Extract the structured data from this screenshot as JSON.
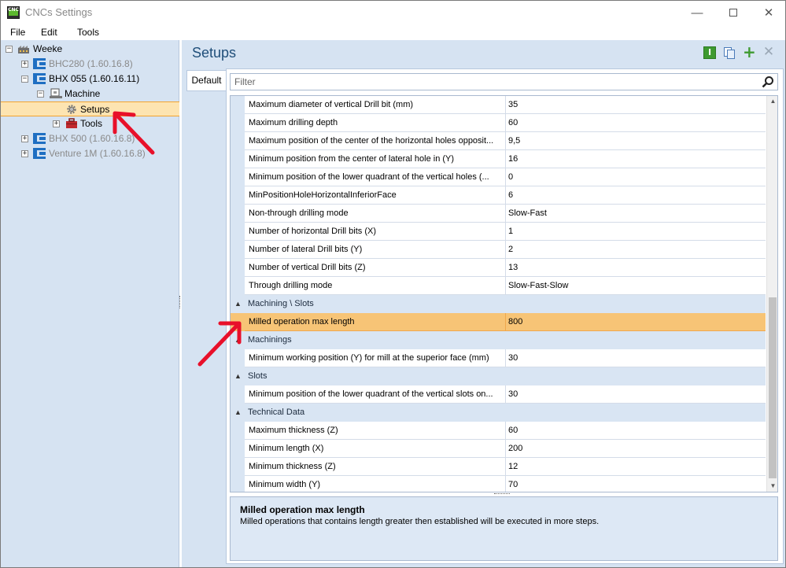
{
  "window": {
    "title": "CNCs Settings",
    "app_icon_text": "CNC",
    "controls": {
      "minimize": "—",
      "maximize": "",
      "close": "✕"
    }
  },
  "menu": {
    "items": [
      "File",
      "Edit",
      "Tools"
    ]
  },
  "tree": {
    "items": [
      {
        "label": "Weeke",
        "expander": "−",
        "icon": "factory-icon",
        "dim": false
      },
      {
        "label": "BHC280 (1.60.16.8)",
        "expander": "+",
        "icon": "cnc-machine-icon",
        "dim": true
      },
      {
        "label": "BHX 055 (1.60.16.11)",
        "expander": "−",
        "icon": "cnc-machine-icon",
        "dim": false
      },
      {
        "label": "Machine",
        "expander": "−",
        "icon": "machine-icon",
        "dim": false
      },
      {
        "label": "Setups",
        "expander": "",
        "icon": "gear-icon",
        "dim": false,
        "selected": true
      },
      {
        "label": "Tools",
        "expander": "+",
        "icon": "toolbox-icon",
        "dim": false
      },
      {
        "label": "BHX 500 (1.60.16.8)",
        "expander": "+",
        "icon": "cnc-machine-icon",
        "dim": true
      },
      {
        "label": "Venture 1M (1.60.16.8)",
        "expander": "+",
        "icon": "cnc-machine-icon",
        "dim": true
      }
    ]
  },
  "content": {
    "title": "Setups",
    "toolbar": {
      "info": "I",
      "copy": "copy-icon",
      "add": "+",
      "delete": "✕"
    },
    "tab_label": "Default",
    "filter_placeholder": "Filter",
    "grid_rows": [
      {
        "type": "property",
        "name": "Maximum diameter of vertical Drill bit (mm)",
        "value": "35"
      },
      {
        "type": "property",
        "name": "Maximum drilling depth",
        "value": "60"
      },
      {
        "type": "property",
        "name": "Maximum position of the center of the horizontal holes opposit...",
        "value": "9,5"
      },
      {
        "type": "property",
        "name": "Minimum position from the center of lateral hole in (Y)",
        "value": "16"
      },
      {
        "type": "property",
        "name": "Minimum position of the lower quadrant of the vertical holes (...",
        "value": "0"
      },
      {
        "type": "property",
        "name": "MinPositionHoleHorizontalInferiorFace",
        "value": "6"
      },
      {
        "type": "property",
        "name": "Non-through drilling mode",
        "value": "Slow-Fast"
      },
      {
        "type": "property",
        "name": "Number of horizontal Drill bits (X)",
        "value": "1"
      },
      {
        "type": "property",
        "name": "Number of lateral Drill bits (Y)",
        "value": "2"
      },
      {
        "type": "property",
        "name": "Number of vertical Drill bits (Z)",
        "value": "13"
      },
      {
        "type": "property",
        "name": "Through drilling mode",
        "value": "Slow-Fast-Slow"
      },
      {
        "type": "category",
        "name": "Machining \\ Slots",
        "toggle": "▲"
      },
      {
        "type": "property",
        "name": "Milled operation max length",
        "value": "800",
        "selected": true
      },
      {
        "type": "category",
        "name": "Machinings",
        "toggle": "▲"
      },
      {
        "type": "property",
        "name": "Minimum working position (Y) for mill at the superior face (mm)",
        "value": "30"
      },
      {
        "type": "category",
        "name": "Slots",
        "toggle": "▲"
      },
      {
        "type": "property",
        "name": "Minimum position of the lower quadrant of the vertical slots on...",
        "value": "30"
      },
      {
        "type": "category",
        "name": "Technical Data",
        "toggle": "▲"
      },
      {
        "type": "property",
        "name": "Maximum thickness (Z)",
        "value": "60"
      },
      {
        "type": "property",
        "name": "Minimum length (X)",
        "value": "200"
      },
      {
        "type": "property",
        "name": "Minimum thickness (Z)",
        "value": "12"
      },
      {
        "type": "property",
        "name": "Minimum width (Y)",
        "value": "70"
      }
    ],
    "scrollbar": {
      "up": "▲",
      "down": "▼"
    },
    "description": {
      "title": "Milled operation max length",
      "text": "Milled operations that contains length greater then established will be executed in more steps."
    }
  },
  "colors": {
    "panel_bg": "#d6e3f2",
    "selected_row": "#f7c476",
    "annotation_arrow": "#e8102a",
    "title_blue": "#1f4e79"
  }
}
